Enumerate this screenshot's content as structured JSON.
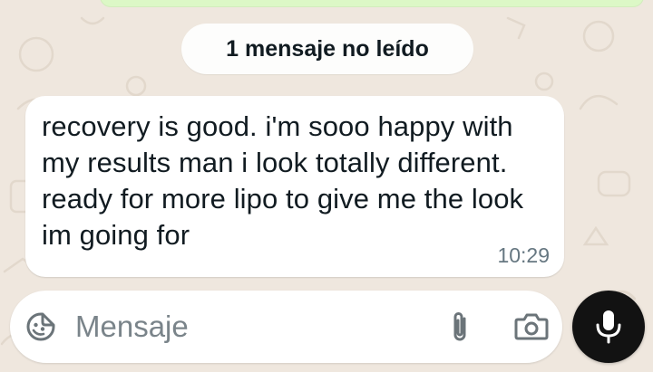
{
  "chat": {
    "unread_banner": "1 mensaje no leído",
    "messages": [
      {
        "text": "recovery is good. i'm sooo happy with my results man i look totally different. ready for more lipo to give me the look im going for",
        "time": "10:29",
        "direction": "incoming"
      }
    ]
  },
  "composer": {
    "placeholder": "Mensaje",
    "value": "",
    "icons": {
      "emoji": "emoji-sticker-icon",
      "attach": "paperclip-icon",
      "camera": "camera-icon",
      "mic": "microphone-icon"
    }
  },
  "colors": {
    "wallpaper": "#efe7de",
    "bubble_incoming": "#ffffff",
    "bubble_outgoing": "#dcf8c6",
    "mic_button": "#121212",
    "icon_gray": "#6b7479",
    "timestamp": "#667781"
  }
}
